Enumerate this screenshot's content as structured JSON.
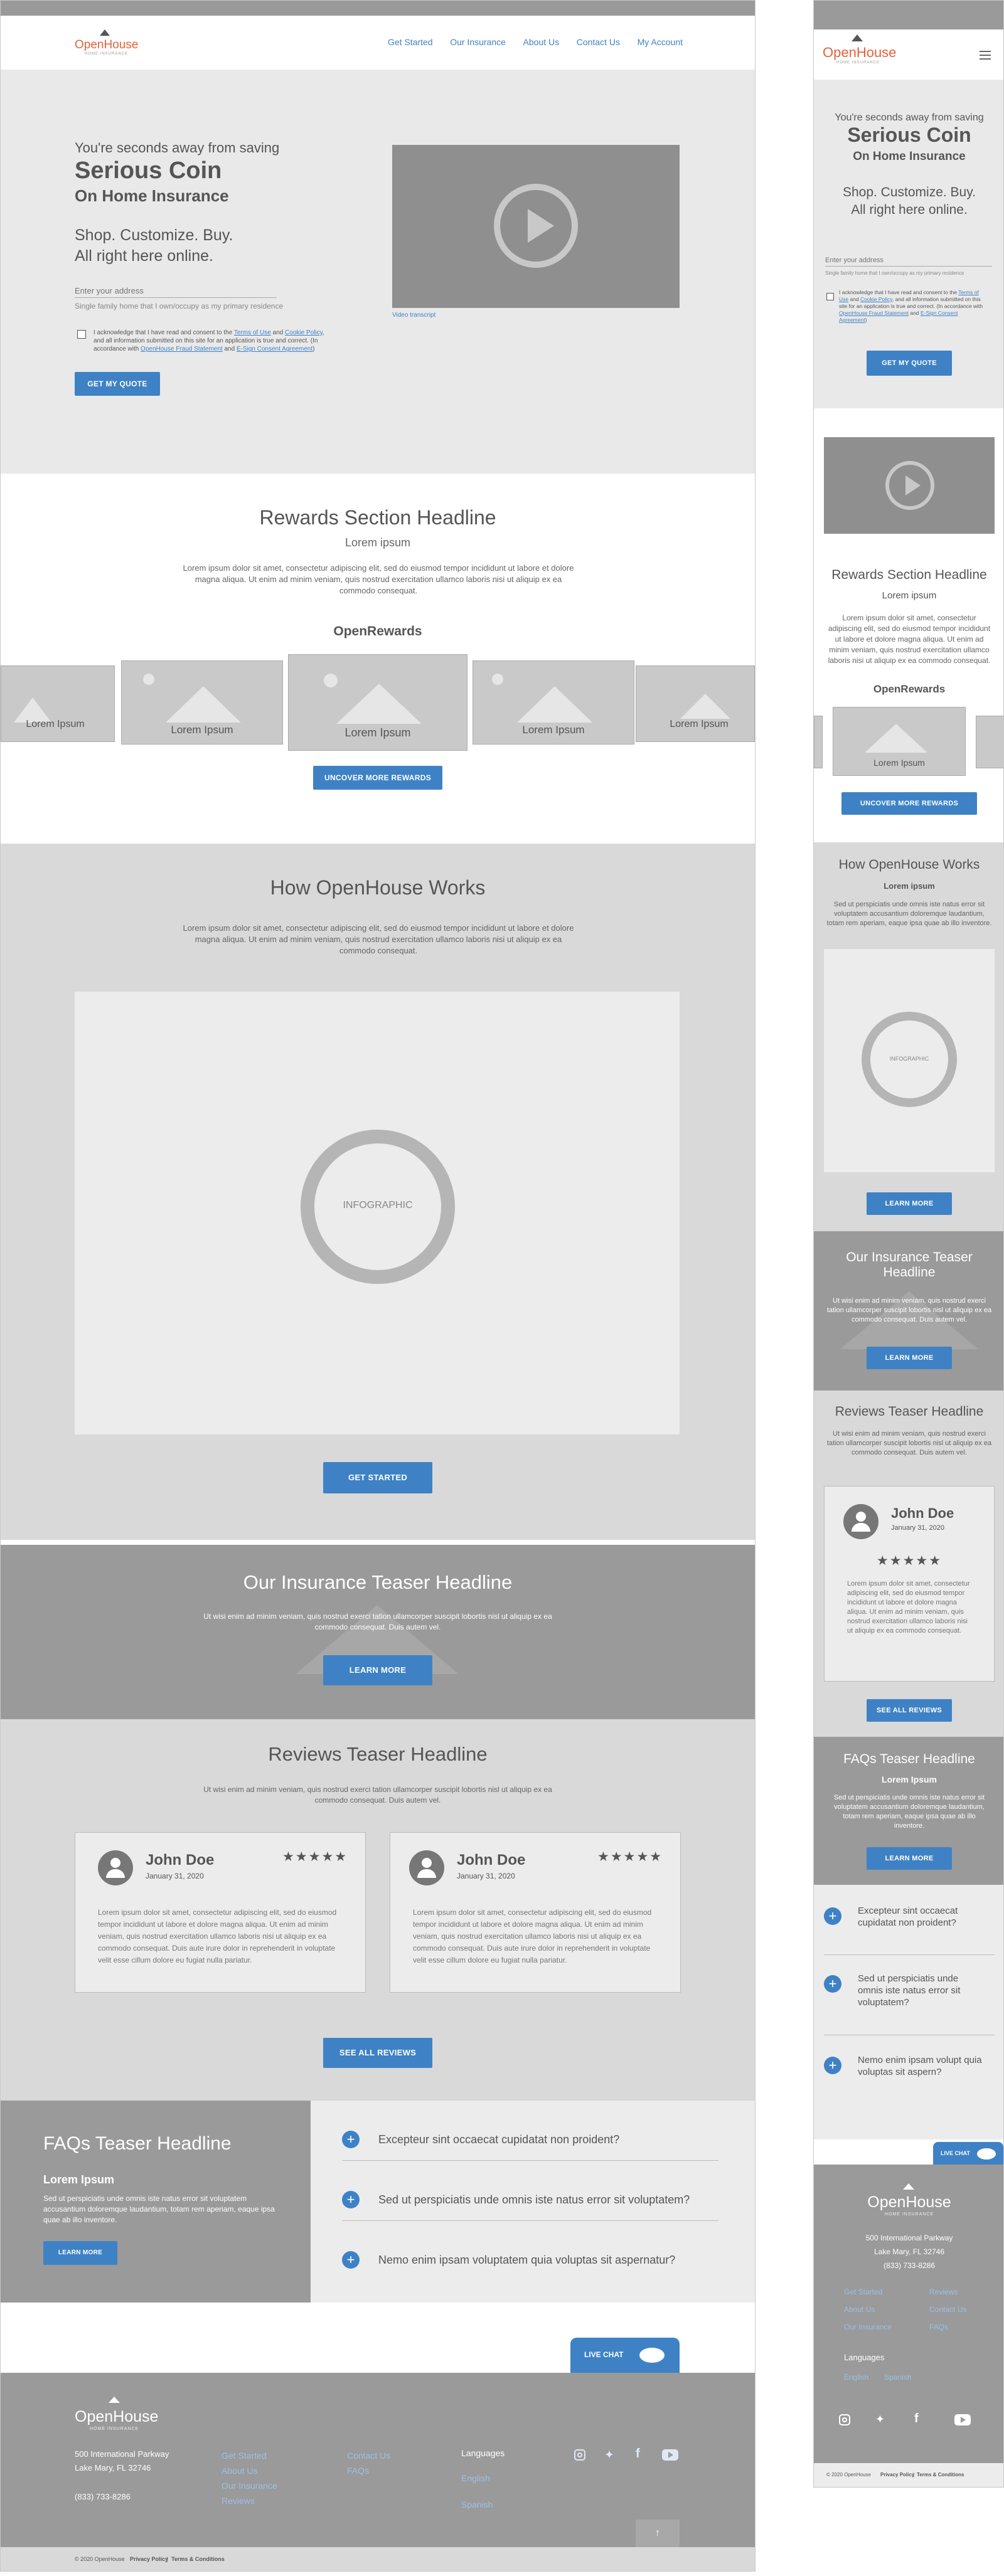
{
  "brand": {
    "name": "OpenHouse",
    "tagline": "HOME INSURANCE"
  },
  "nav": [
    "Get Started",
    "Our Insurance",
    "About Us",
    "Contact Us",
    "My Account"
  ],
  "hero": {
    "kicker": "You're seconds away from saving",
    "headline": "Serious Coin",
    "sub": "On Home Insurance",
    "lead1": "Shop. Customize. Buy.",
    "lead2": "All right here online.",
    "address_placeholder": "Enter your address",
    "address_hint": "Single family home that I own/occupy as my primary residence",
    "consent_pre": "I acknowledge that I have read and consent to the ",
    "terms": "Terms of Use",
    "and": " and ",
    "cookie": "Cookie Policy",
    "consent_mid": ", and all information submitted on this site for an application is true and correct. (In accordance with ",
    "fraud": "OpenHouse Fraud Statement",
    "and2": " and ",
    "esign": "E-Sign Consent Agreement",
    "close": ")",
    "cta": "GET MY QUOTE",
    "video_link": "Video transcript"
  },
  "rewards": {
    "headline": "Rewards Section Headline",
    "sub": "Lorem ipsum",
    "body": "Lorem ipsum dolor sit amet, consectetur adipiscing elit, sed do eiusmod tempor incididunt ut labore et dolore magna aliqua. Ut enim ad minim veniam, quis nostrud exercitation ullamco laboris nisi ut aliquip ex ea commodo consequat.",
    "label": "OpenRewards",
    "card": "Lorem Ipsum",
    "cta": "UNCOVER MORE REWARDS"
  },
  "how": {
    "headline": "How OpenHouse Works",
    "body": "Lorem ipsum dolor sit amet, consectetur adipiscing elit, sed do eiusmod tempor incididunt ut labore et dolore magna aliqua. Ut enim ad minim veniam, quis nostrud exercitation ullamco laboris nisi ut aliquip ex ea commodo consequat.",
    "infographic": "INFOGRAPHIC",
    "cta": "GET STARTED"
  },
  "insurance": {
    "headline": "Our Insurance Teaser Headline",
    "body": "Ut wisi enim ad minim veniam, quis nostrud exerci tation ullamcorper suscipit lobortis nisl ut aliquip ex ea commodo consequat. Duis autem vel.",
    "cta": "LEARN MORE"
  },
  "reviews": {
    "headline": "Reviews Teaser Headline",
    "body": "Ut wisi enim ad minim veniam, quis nostrud exerci tation ullamcorper suscipit lobortis nisl ut aliquip ex ea commodo consequat. Duis autem vel.",
    "name": "John Doe",
    "date": "January 31, 2020",
    "stars": "★★★★★",
    "text": "Lorem ipsum dolor sit amet, consectetur adipiscing elit, sed do eiusmod tempor incididunt ut labore et dolore magna aliqua. Ut enim ad minim veniam, quis nostrud exercitation ullamco laboris nisi ut aliquip ex ea commodo consequat. Duis aute irure dolor in reprehenderit in voluptate velit esse cillum dolore eu fugiat nulla pariatur.",
    "text_m": "Lorem ipsum dolor sit amet, consectetur adipiscing elit, sed do eiusmod tempor incididunt ut labore et dolore magna aliqua. Ut enim ad minim veniam, quis nostrud exercitation ullamco laboris nisi ut aliquip ex ea commodo consequat.",
    "cta": "SEE ALL REVIEWS"
  },
  "faq": {
    "headline": "FAQs Teaser Headline",
    "sub": "Lorem Ipsum",
    "body": "Sed ut perspiciatis unde omnis iste natus error sit voluptatem accusantium doloremque laudantium, totam rem aperiam, eaque ipsa quae ab illo inventore.",
    "cta": "LEARN MORE",
    "q1": "Excepteur sint occaecat cupidatat non proident?",
    "q2": "Sed ut perspiciatis unde omnis iste natus error sit voluptatem?",
    "q3": "Nemo enim ipsam voluptatem quia voluptas sit aspernatur?",
    "q2m": "Sed ut perspiciatis unde omnis iste natus error sit voluptatem?",
    "q3m": "Nemo enim ipsam volupt quia voluptas sit aspern?"
  },
  "chat": "LIVE CHAT",
  "footer": {
    "addr1": "500 International Parkway",
    "addr2": "Lake Mary, FL 32746",
    "phone": "(833) 733-8286",
    "links1": [
      "Get Started",
      "About Us",
      "Our Insurance",
      "Reviews"
    ],
    "links2": [
      "Contact Us",
      "FAQs"
    ],
    "lang_label": "Languages",
    "lang1": "English",
    "lang2": "Spanish",
    "copy": "© 2020 OpenHouse",
    "privacy": "Privacy Policy",
    "terms": "Terms & Conditions",
    "sep": "|"
  },
  "colors": {
    "accent": "#3e82c5",
    "brand": "#e8623a",
    "gray": "#9a9a9a"
  }
}
